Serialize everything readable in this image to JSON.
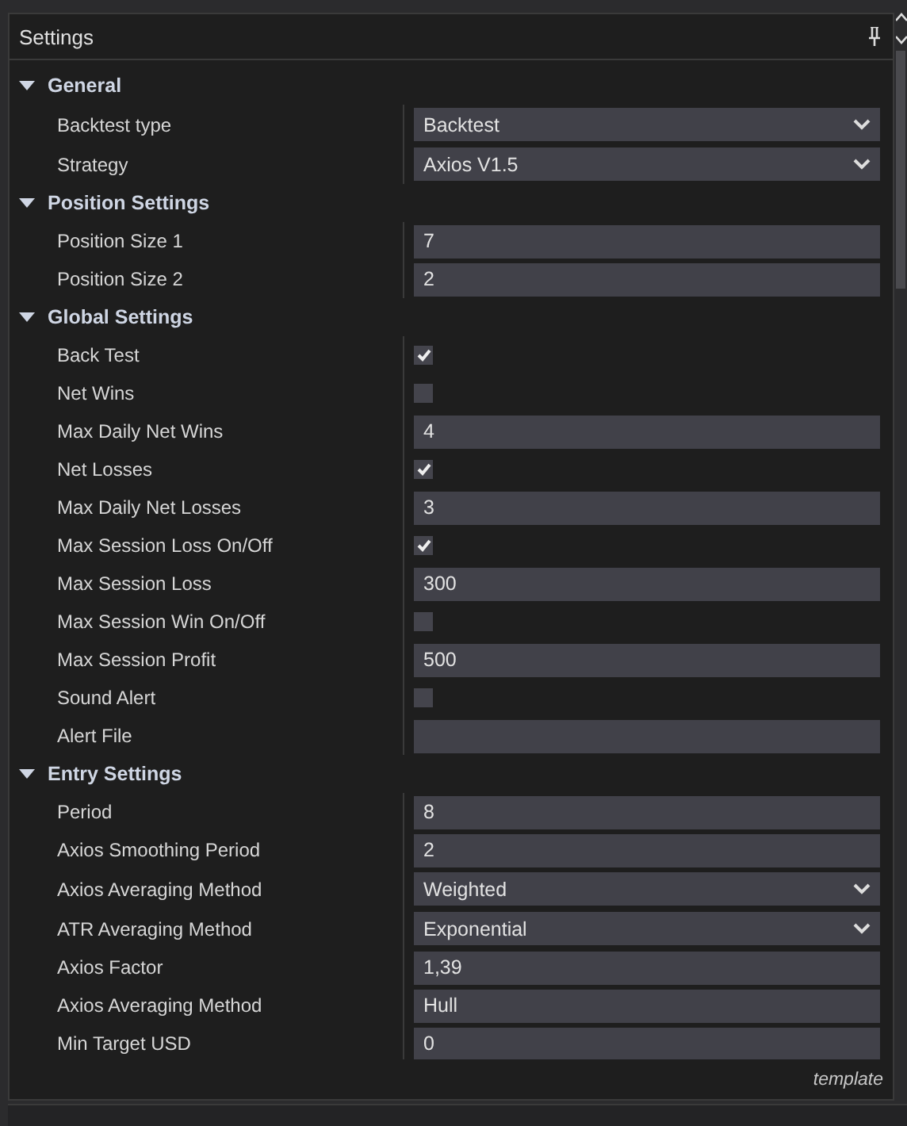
{
  "panel": {
    "title": "Settings"
  },
  "sections": [
    {
      "title": "General",
      "expanded": true,
      "rows": [
        {
          "label": "Backtest type",
          "kind": "dropdown",
          "value": "Backtest"
        },
        {
          "label": "Strategy",
          "kind": "dropdown",
          "value": "Axios V1.5"
        }
      ]
    },
    {
      "title": "Position Settings",
      "expanded": true,
      "rows": [
        {
          "label": "Position Size 1",
          "kind": "text",
          "value": "7"
        },
        {
          "label": "Position Size 2",
          "kind": "text",
          "value": "2"
        }
      ]
    },
    {
      "title": "Global Settings",
      "expanded": true,
      "rows": [
        {
          "label": "Back Test",
          "kind": "checkbox",
          "checked": true
        },
        {
          "label": "Net Wins",
          "kind": "checkbox",
          "checked": false
        },
        {
          "label": "Max Daily Net Wins",
          "kind": "text",
          "value": "4"
        },
        {
          "label": "Net Losses",
          "kind": "checkbox",
          "checked": true
        },
        {
          "label": "Max Daily Net Losses",
          "kind": "text",
          "value": "3"
        },
        {
          "label": "Max Session Loss On/Off",
          "kind": "checkbox",
          "checked": true
        },
        {
          "label": "Max Session Loss",
          "kind": "text",
          "value": "300"
        },
        {
          "label": "Max Session Win On/Off",
          "kind": "checkbox",
          "checked": false
        },
        {
          "label": "Max Session Profit",
          "kind": "text",
          "value": "500"
        },
        {
          "label": "Sound Alert",
          "kind": "checkbox",
          "checked": false
        },
        {
          "label": "Alert File",
          "kind": "text"
        }
      ]
    },
    {
      "title": "Entry Settings",
      "expanded": true,
      "rows": [
        {
          "label": "Period",
          "kind": "text",
          "value": "8"
        },
        {
          "label": "Axios Smoothing Period",
          "kind": "text",
          "value": "2"
        },
        {
          "label": "Axios Averaging Method",
          "kind": "dropdown",
          "value": "Weighted"
        },
        {
          "label": "ATR Averaging Method",
          "kind": "dropdown",
          "value": "Exponential"
        },
        {
          "label": "Axios Factor",
          "kind": "text",
          "value": "1,39"
        },
        {
          "label": "Axios Averaging Method",
          "kind": "text",
          "value": "Hull"
        },
        {
          "label": "Min Target USD",
          "kind": "text",
          "value": "0"
        }
      ]
    }
  ],
  "footer": {
    "template": "template"
  }
}
